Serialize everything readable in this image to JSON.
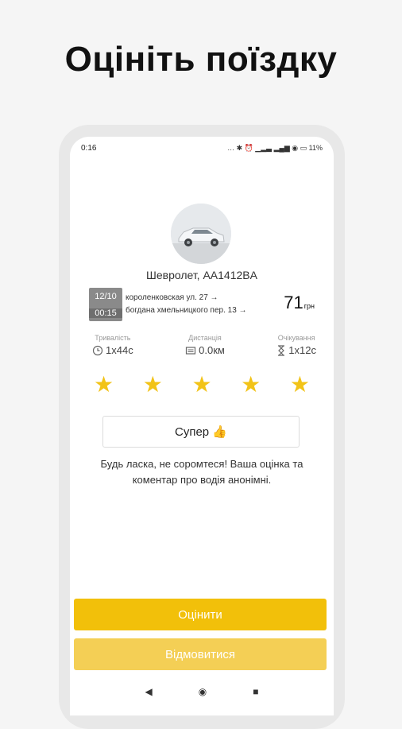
{
  "headline": "Оцініть поїздку",
  "status_bar": {
    "time": "0:16",
    "icons_text": "… ✱ ⏰ ▁▂▃ ▂▄▆ ◉ ▭ 11%"
  },
  "car": {
    "name": "Шевролет, AA1412BA",
    "photo_icon": "car-photo"
  },
  "trip": {
    "date": "12/10",
    "time": "00:15",
    "from": "короленковская ул. 27",
    "to": "богдана хмельницкого пер. 13",
    "arrow": "→",
    "price": "71",
    "currency": "грн"
  },
  "stats": {
    "duration": {
      "label": "Тривалість",
      "value": "1x44c"
    },
    "distance": {
      "label": "Дистанція",
      "value": "0.0км"
    },
    "waiting": {
      "label": "Очікування",
      "value": "1x12c"
    }
  },
  "rating": {
    "stars": [
      "★",
      "★",
      "★",
      "★",
      "★"
    ],
    "value": 5,
    "color": "#f2c318"
  },
  "feedback_chip": "Супер 👍",
  "note": "Будь ласка, не соромтеся! Ваша оцінка та коментар про водія анонімні.",
  "buttons": {
    "rate": "Оцінити",
    "decline": "Відмовитися"
  },
  "nav": {
    "back": "◀",
    "home": "◉",
    "recents": "■"
  },
  "colors": {
    "accent": "#f2c00a",
    "accent_light": "#f4cf55"
  }
}
